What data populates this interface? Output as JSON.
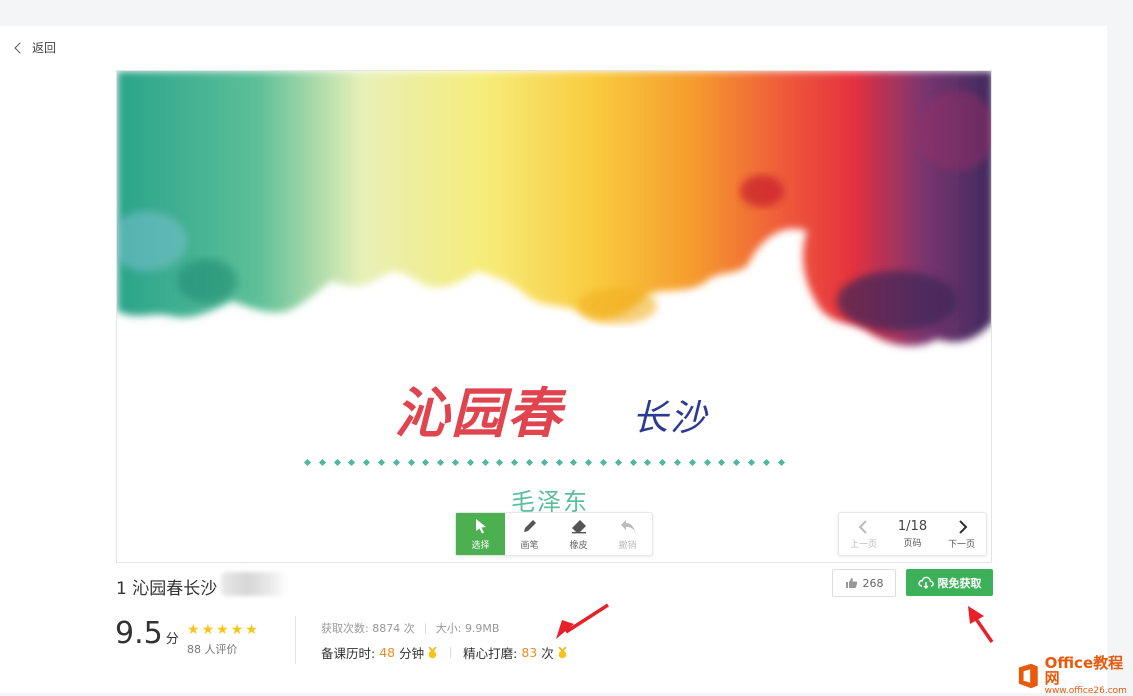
{
  "nav": {
    "back_label": "返回"
  },
  "slide": {
    "title": "沁园春",
    "subtitle": "长沙",
    "author": "毛泽东"
  },
  "toolbar": {
    "tools": [
      {
        "label": "选择",
        "icon": "cursor-icon"
      },
      {
        "label": "画笔",
        "icon": "pen-icon"
      },
      {
        "label": "橡皮",
        "icon": "eraser-icon"
      },
      {
        "label": "撤销",
        "icon": "undo-icon"
      }
    ]
  },
  "pager": {
    "prev_label": "上一页",
    "page_indicator": "1/18",
    "page_label": "页码",
    "next_label": "下一页"
  },
  "document": {
    "title": "1 沁园春长沙"
  },
  "actions": {
    "like_count": "268",
    "get_label": "限免获取"
  },
  "rating": {
    "score": "9.5",
    "score_unit": "分",
    "stars": 5,
    "raters": "88 人评价"
  },
  "stats": {
    "downloads_label": "获取次数:",
    "downloads_value": "8874 次",
    "size_label": "大小:",
    "size_value": "9.9MB",
    "prep_label": "备课历时:",
    "prep_value": "48",
    "prep_unit": "分钟",
    "polish_label": "精心打磨:",
    "polish_value": "83",
    "polish_unit": "次"
  },
  "watermark": {
    "brand": "Office教程网",
    "url": "www.office26.com"
  },
  "colors": {
    "accent_green": "#3db15a",
    "highlight_orange": "#f08c1f",
    "annotation_red": "#e8202a"
  }
}
